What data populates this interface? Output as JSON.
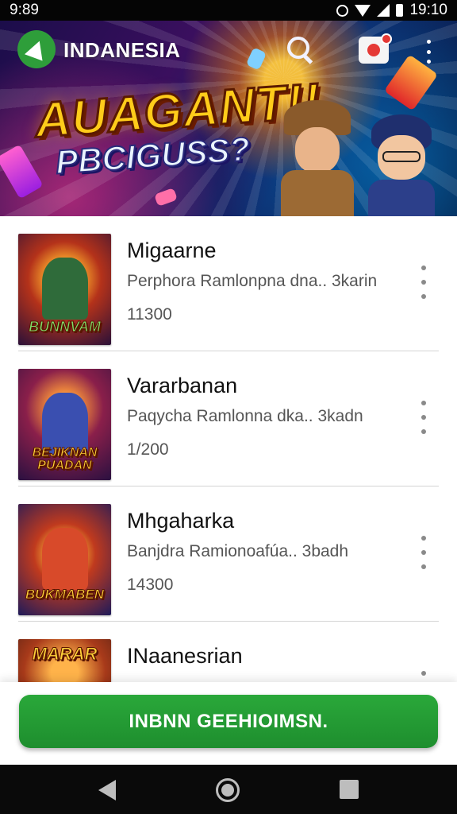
{
  "status_bar": {
    "time_left": "9:89",
    "time_right": "19:10"
  },
  "app": {
    "name": "INDANESIA"
  },
  "banner": {
    "title": "AUAGANT!!",
    "subtitle": "PBCIGUSS?"
  },
  "list": {
    "items": [
      {
        "title": "Migaarne",
        "subtitle": "Perphora Ramlonpna dna.. 3karin",
        "count": "11300",
        "thumb_text": "BUNNVAM"
      },
      {
        "title": "Vararbanan",
        "subtitle": "Paqycha Ramlonna dka.. 3kadn",
        "count": "1/200",
        "thumb_text": "BEJIKNAN PUADAN"
      },
      {
        "title": "Mhgaharka",
        "subtitle": "Banjdra Ramionoafúa.. 3badh",
        "count": "14300",
        "thumb_text": "BUKMABEN"
      },
      {
        "title": "INaanesrian",
        "subtitle": "",
        "count": "",
        "thumb_text": "MARAR"
      }
    ]
  },
  "cta": {
    "label": "INBNN GEEHIOIMSN."
  },
  "colors": {
    "cta_green": "#1e8e2e",
    "text_primary": "#111111",
    "text_secondary": "#555555"
  }
}
